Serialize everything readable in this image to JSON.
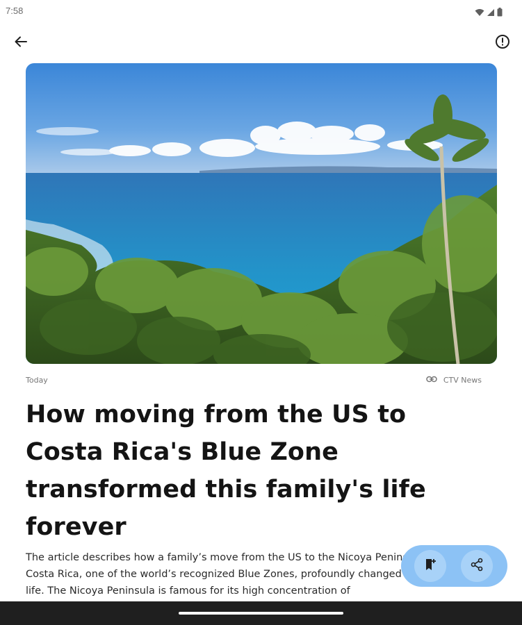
{
  "status_bar": {
    "time": "7:58",
    "icons": [
      "wifi-icon",
      "signal-icon",
      "battery-icon"
    ]
  },
  "app_bar": {
    "back_icon": "arrow-back-icon",
    "report_icon": "alert-circle-icon"
  },
  "article": {
    "image_description_icon": "coastal-landscape-image",
    "date": "Today",
    "source": "CTV News",
    "source_icon": "link-icon",
    "headline": "How moving from the US to Costa Rica's Blue Zone transformed this family's life forever",
    "summary": "The article describes how a family’s move from the US to the Nicoya Peninsula in Costa Rica, one of the world’s recognized Blue Zones, profoundly changed their life. The Nicoya Peninsula is famous for its high concentration of"
  },
  "actions": {
    "save_icon": "bookmark-add-icon",
    "share_icon": "share-icon",
    "pill_color": "#8cc2f5"
  },
  "colors": {
    "headline": "#141414",
    "body": "#2a2a2a",
    "meta": "#777777",
    "nav_bar": "#1f1f1f"
  }
}
